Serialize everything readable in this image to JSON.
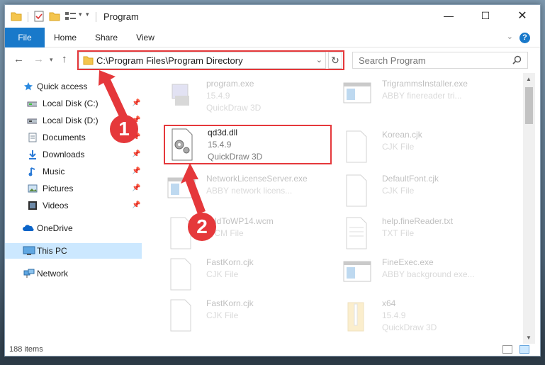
{
  "window": {
    "title": "Program"
  },
  "ribbon": {
    "tabs": [
      "File",
      "Home",
      "Share",
      "View"
    ],
    "help": "?"
  },
  "address": {
    "path": "C:\\Program Files\\Program Directory"
  },
  "search": {
    "placeholder": "Search Program"
  },
  "sidebar": {
    "quick_access": "Quick access",
    "items": [
      {
        "label": "Local Disk (C:)",
        "icon": "drive-icon"
      },
      {
        "label": "Local Disk (D:)",
        "icon": "drive-icon"
      },
      {
        "label": "Documents",
        "icon": "documents-icon"
      },
      {
        "label": "Downloads",
        "icon": "downloads-icon"
      },
      {
        "label": "Music",
        "icon": "music-icon"
      },
      {
        "label": "Pictures",
        "icon": "pictures-icon"
      },
      {
        "label": "Videos",
        "icon": "videos-icon"
      }
    ],
    "onedrive": "OneDrive",
    "this_pc": "This PC",
    "network": "Network"
  },
  "files": [
    {
      "name": "program.exe",
      "line1": "15.4.9",
      "line2": "QuickDraw 3D"
    },
    {
      "name": "TrigrammsInstaller.exe",
      "line1": "ABBY finereader tri...",
      "line2": ""
    },
    {
      "name": "qd3d.dll",
      "line1": "15.4.9",
      "line2": "QuickDraw 3D"
    },
    {
      "name": "Korean.cjk",
      "line1": "CJK File",
      "line2": ""
    },
    {
      "name": "NetworkLicenseServer.exe",
      "line1": "ABBY network licens...",
      "line2": ""
    },
    {
      "name": "DefaultFont.cjk",
      "line1": "CJK File",
      "line2": ""
    },
    {
      "name": "AddToWP14.wcm",
      "line1": "WCM File",
      "line2": ""
    },
    {
      "name": "help.fineReader.txt",
      "line1": "TXT File",
      "line2": ""
    },
    {
      "name": "FastKorn.cjk",
      "line1": "CJK File",
      "line2": ""
    },
    {
      "name": "FineExec.exe",
      "line1": "ABBY background exe...",
      "line2": ""
    },
    {
      "name": "FastKorn.cjk",
      "line1": "CJK File",
      "line2": ""
    },
    {
      "name": "x64",
      "line1": "15.4.9",
      "line2": "QuickDraw 3D"
    }
  ],
  "status": {
    "item_count": "188 items"
  },
  "annotations": {
    "step1": "1",
    "step2": "2"
  },
  "colors": {
    "accent": "#1979ca",
    "highlight": "#e5383b",
    "selection": "#cce8ff"
  }
}
